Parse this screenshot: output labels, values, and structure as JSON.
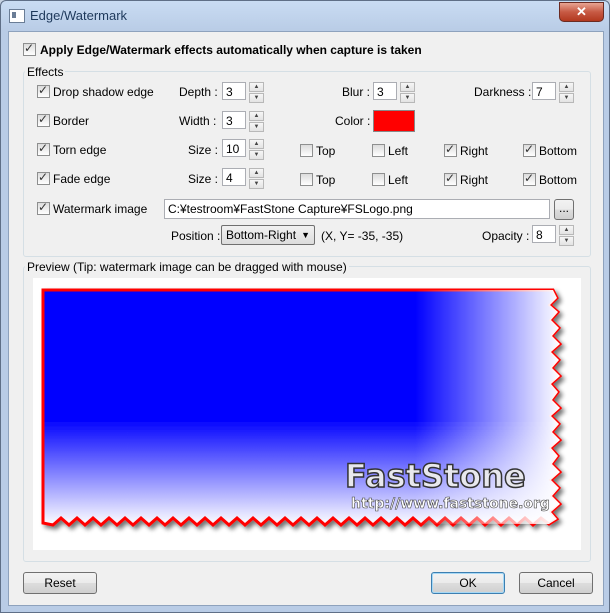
{
  "window": {
    "title": "Edge/Watermark",
    "close_glyph": "✕"
  },
  "auto_apply": {
    "label": "Apply Edge/Watermark effects automatically when capture is taken",
    "checked": true
  },
  "effects_group": {
    "title": "Effects"
  },
  "drop_shadow": {
    "label": "Drop shadow edge",
    "checked": true,
    "depth_label": "Depth :",
    "depth": "3",
    "blur_label": "Blur :",
    "blur": "3",
    "darkness_label": "Darkness :",
    "darkness": "7"
  },
  "border": {
    "label": "Border",
    "checked": true,
    "width_label": "Width :",
    "width": "3",
    "color_label": "Color :",
    "color": "#ff0000"
  },
  "torn_edge": {
    "label": "Torn edge",
    "checked": true,
    "size_label": "Size :",
    "size": "10",
    "top": "Top",
    "left": "Left",
    "right": "Right",
    "bottom": "Bottom"
  },
  "fade_edge": {
    "label": "Fade edge",
    "checked": true,
    "size_label": "Size :",
    "size": "4",
    "top": "Top",
    "left": "Left",
    "right": "Right",
    "bottom": "Bottom"
  },
  "watermark": {
    "label": "Watermark image",
    "checked": true,
    "path": "C:¥testroom¥FastStone Capture¥FSLogo.png",
    "browse_label": "...",
    "position_label": "Position :",
    "position_value": "Bottom-Right",
    "coords": "(X, Y= -35, -35)",
    "opacity_label": "Opacity :",
    "opacity": "8"
  },
  "preview_group": {
    "title": "Preview (Tip: watermark image can be dragged with mouse)"
  },
  "preview": {
    "logo_text": "FastStone",
    "logo_url": "http://www.faststone.org",
    "fill_color": "#0000ff",
    "border_color": "#ff0000"
  },
  "buttons": {
    "reset": "Reset",
    "ok": "OK",
    "cancel": "Cancel"
  }
}
